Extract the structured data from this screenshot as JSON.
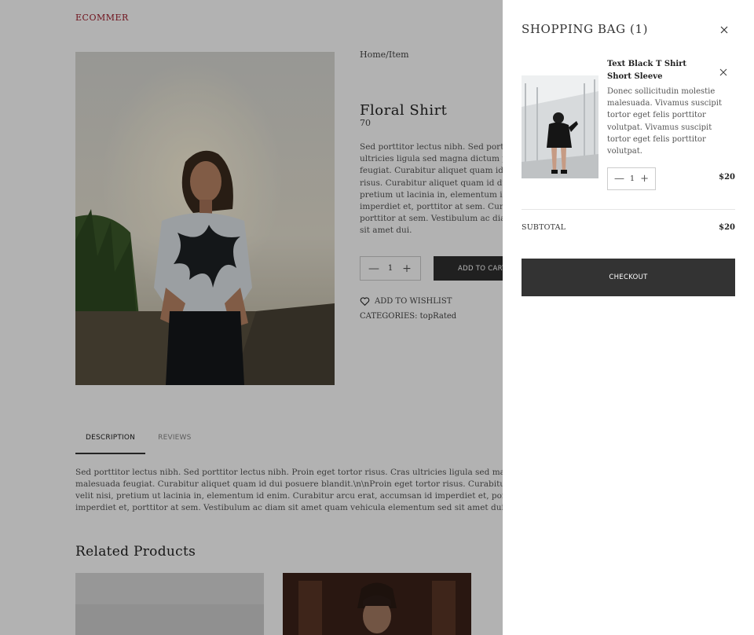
{
  "brand": "ECOMMER",
  "breadcrumb": "Home/Item",
  "product": {
    "title": "Floral Shirt",
    "price": "70",
    "description_lines": [
      "Sed porttitor lectus nibh. Sed porttitor",
      "ultricies ligula sed magna dictum porta",
      "feugiat. Curabitur aliquet quam id dui",
      "risus. Curabitur aliquet quam id dui po",
      "pretium ut lacinia in, elementum id en",
      "imperdiet et, porttitor at sem. Curabitu",
      "porttitor at sem. Vestibulum ac diam sit",
      "sit amet dui."
    ],
    "quantity": "1",
    "add_to_cart": "ADD TO CART",
    "wishlist": "ADD TO WISHLIST",
    "categories": "CATEGORIES: topRated"
  },
  "tabs": {
    "description": "DESCRIPTION",
    "reviews": "REVIEWS"
  },
  "long_description_lines": [
    "Sed porttitor lectus nibh. Sed porttitor lectus nibh. Proin eget tortor risus. Cras ultricies ligula sed magna dictum",
    "malesuada feugiat. Curabitur aliquet quam id dui posuere blandit.\\n\\nProin eget tortor risus. Curabitur aliquet",
    "velit nisi, pretium ut lacinia in, elementum id enim. Curabitur arcu erat, accumsan id imperdiet et, porttitor",
    "imperdiet et, porttitor at sem. Vestibulum ac diam sit amet quam vehicula elementum sed sit amet dui."
  ],
  "related_title": "Related Products",
  "cart": {
    "title": "SHOPPING BAG (1)",
    "item": {
      "name": "Text Black T Shirt Short Sleeve",
      "description": "Donec sollicitudin molestie malesuada. Vivamus suscipit tortor eget felis porttitor volutpat. Vivamus suscipit tortor eget felis porttitor volutpat.",
      "quantity": "1",
      "price": "$20"
    },
    "subtotal_label": "SUBTOTAL",
    "subtotal_value": "$20",
    "checkout": "CHECKOUT"
  },
  "colors": {
    "brand": "#a01c2a",
    "dark_button": "#333333",
    "overlay": "rgba(0,0,0,0.30)"
  }
}
